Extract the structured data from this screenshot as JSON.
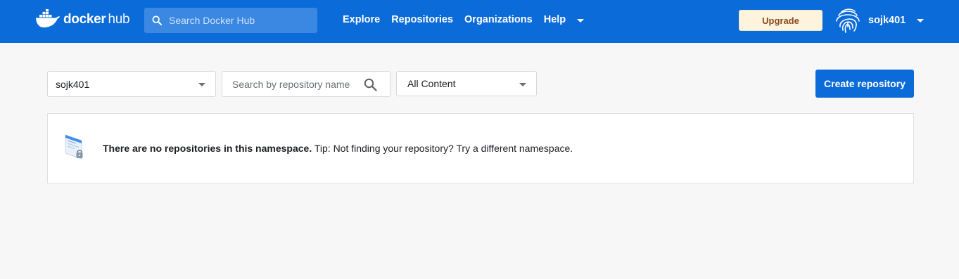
{
  "header": {
    "logo_text": "docker",
    "logo_sub": "hub",
    "search_placeholder": "Search Docker Hub",
    "nav": [
      {
        "label": "Explore"
      },
      {
        "label": "Repositories"
      },
      {
        "label": "Organizations"
      },
      {
        "label": "Help"
      }
    ],
    "upgrade_label": "Upgrade",
    "username": "sojk401"
  },
  "toolbar": {
    "namespace_value": "sojk401",
    "repo_search_placeholder": "Search by repository name",
    "content_filter_value": "All Content",
    "create_label": "Create repository"
  },
  "empty_state": {
    "bold_text": "There are no repositories in this namespace.",
    "tip_text": " Tip: Not finding your repository? Try a different namespace."
  },
  "colors": {
    "brand_blue": "#0b6bd9",
    "upgrade_bg": "#fef3dc",
    "upgrade_text": "#8a4a1f",
    "page_bg": "#f7f7f7"
  },
  "icons": {
    "logo": "docker-whale-icon",
    "search": "search-icon",
    "avatar": "fingerprint-icon",
    "empty": "repository-lock-illustration"
  }
}
